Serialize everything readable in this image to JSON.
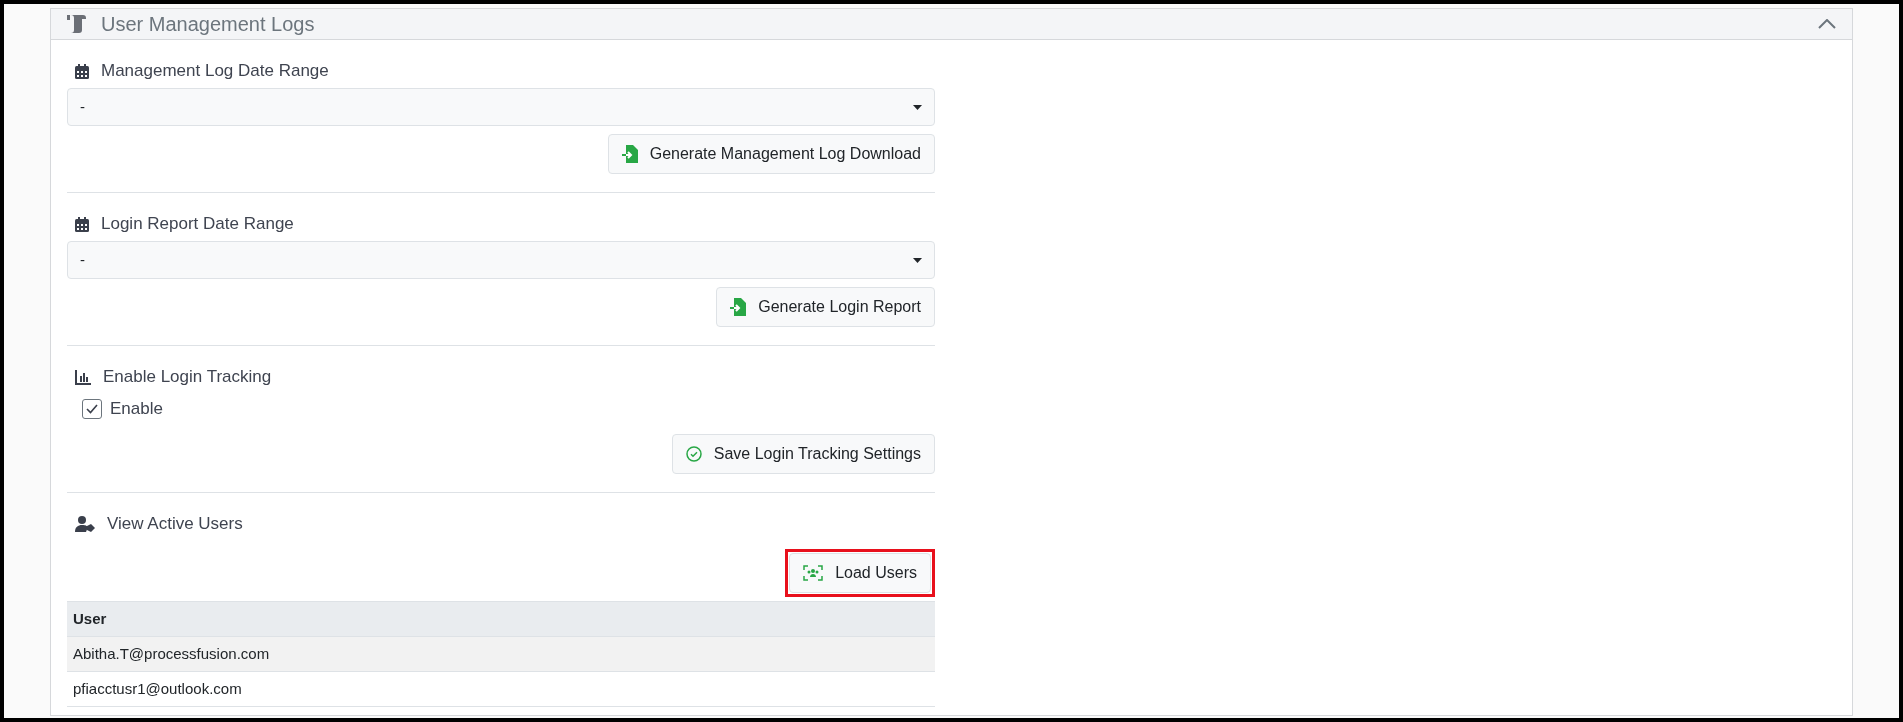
{
  "panel": {
    "title": "User Management Logs",
    "expanded": true
  },
  "sections": [
    {
      "kind": "date_range",
      "label": "Management Log Date Range",
      "select_value": "-",
      "button": {
        "label": "Generate Management Log Download",
        "highlighted": false
      }
    },
    {
      "kind": "date_range",
      "label": "Login Report Date Range",
      "select_value": "-",
      "button": {
        "label": "Generate Login Report",
        "highlighted": false
      }
    },
    {
      "kind": "toggle",
      "label": "Enable Login Tracking",
      "checkbox": {
        "label": "Enable",
        "checked": true
      },
      "button": {
        "label": "Save Login Tracking Settings",
        "highlighted": false
      }
    },
    {
      "kind": "users",
      "label": "View Active Users",
      "button": {
        "label": "Load Users",
        "highlighted": true
      },
      "table": {
        "columns": [
          "User"
        ],
        "rows": [
          [
            "Abitha.T@processfusion.com"
          ],
          [
            "pfiacctusr1@outlook.com"
          ]
        ]
      }
    }
  ]
}
